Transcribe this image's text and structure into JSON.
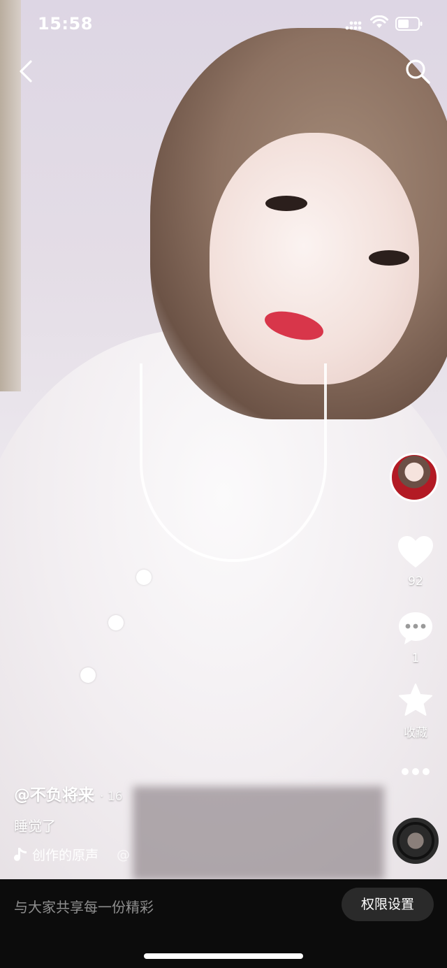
{
  "status_bar": {
    "time": "15:58",
    "icons": [
      "signal-icon",
      "wifi-icon",
      "battery-icon"
    ]
  },
  "top_nav": {
    "back_icon": "chevron-left-icon",
    "search_icon": "search-icon"
  },
  "video": {
    "description_icon_names": [
      "avatar",
      "heart-icon",
      "comment-icon",
      "star-icon",
      "more-icon",
      "music-disc"
    ]
  },
  "rail": {
    "like_count": "92",
    "comment_count": "1",
    "favorite_label": "收藏"
  },
  "caption": {
    "author": "@不负将来",
    "date": "· 16",
    "description": "睡觉了",
    "music_label": "创作的原声",
    "mention": "@"
  },
  "bottom_bar": {
    "share_text": "与大家共享每一份精彩",
    "permission_button": "权限设置"
  },
  "colors": {
    "accent_lips": "#d8364a",
    "bottom_bar_bg": "#0c0c0c",
    "button_bg": "#2a2a2a"
  }
}
